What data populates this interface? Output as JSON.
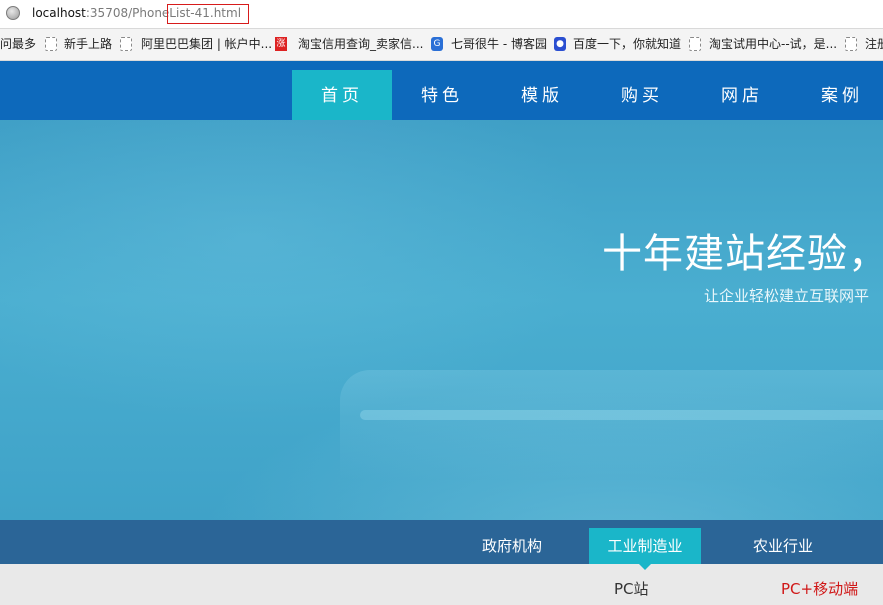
{
  "browser": {
    "url_host": "localhost",
    "url_rest": ":35708/PhoneList-41.html",
    "bookmarks": [
      {
        "label": "问最多",
        "icon": "none"
      },
      {
        "label": "新手上路",
        "icon": "page-icon"
      },
      {
        "label": "阿里巴巴集团 | 帐户中...",
        "icon": "page-icon"
      },
      {
        "label": "淘宝信用查询_卖家信...",
        "icon": "taobao-icon"
      },
      {
        "label": "七哥很牛 - 博客园",
        "icon": "blog-icon"
      },
      {
        "label": "百度一下，你就知道",
        "icon": "baidu-icon"
      },
      {
        "label": "淘宝试用中心--试，是...",
        "icon": "page-icon"
      },
      {
        "label": "注册",
        "icon": "page-icon"
      }
    ]
  },
  "nav": {
    "items": [
      "首页",
      "特色",
      "模版",
      "购买",
      "网店",
      "案例"
    ],
    "active_index": 0
  },
  "hero": {
    "title": "十年建站经验，",
    "subtitle": "让企业轻松建立互联网平"
  },
  "categories": {
    "items": [
      "政府机构",
      "工业制造业",
      "农业行业"
    ],
    "active_index": 1
  },
  "sub_tabs": {
    "pc": "PC站",
    "mobile": "PC+移动端"
  },
  "colors": {
    "nav_bg": "#0d69bb",
    "accent": "#1ab6c9",
    "category_bg": "#2b6597",
    "mobile_tab": "#d01717"
  }
}
